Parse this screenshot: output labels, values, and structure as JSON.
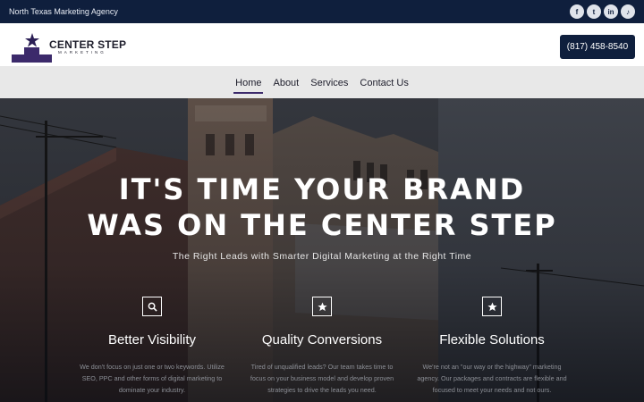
{
  "topbar": {
    "tagline": "North Texas Marketing Agency",
    "socials": [
      {
        "name": "facebook-icon",
        "glyph": "f"
      },
      {
        "name": "twitter-icon",
        "glyph": "t"
      },
      {
        "name": "linkedin-icon",
        "glyph": "in"
      },
      {
        "name": "tiktok-icon",
        "glyph": "♪"
      }
    ]
  },
  "header": {
    "logo_name": "CENTER STEP",
    "logo_sub": "MARKETING",
    "phone": "(817) 458-8540"
  },
  "nav": {
    "items": [
      "Home",
      "About",
      "Services",
      "Contact Us"
    ],
    "active": "Home"
  },
  "hero": {
    "headline_line1": "IT'S TIME YOUR BRAND",
    "headline_line2": "WAS ON THE CENTER STEP",
    "subhead": "The Right Leads with Smarter Digital Marketing at the Right Time"
  },
  "features": [
    {
      "icon": "search-icon",
      "title": "Better Visibility",
      "desc": "We don't focus on just one or two keywords. Utilize SEO, PPC and other forms of digital marketing to dominate your industry."
    },
    {
      "icon": "star-icon",
      "title": "Quality Conversions",
      "desc": "Tired of unqualified leads? Our team takes time to focus on your business model and develop proven strategies to drive the leads you need."
    },
    {
      "icon": "star-icon",
      "title": "Flexible Solutions",
      "desc": "We're not an \"our way or the highway\" marketing agency. Our packages and contracts are flexible and focused to meet your needs and not ours."
    }
  ],
  "colors": {
    "navy": "#0f1f3d",
    "purple": "#3c2a6b",
    "nav_bg": "#e8e8e8"
  }
}
